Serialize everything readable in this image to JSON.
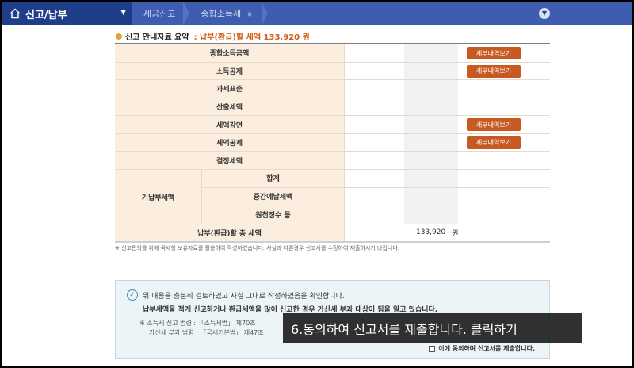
{
  "nav": {
    "main_label": "신고/납부",
    "crumbs": [
      "세금신고",
      "종합소득세"
    ],
    "star": "★"
  },
  "summary": {
    "title": "신고 안내자료 요약",
    "amount_text": ": 납부(환급)할 세액 133,920 원"
  },
  "table": {
    "rows": [
      {
        "label": "종합소득금액",
        "button": "세부내역보기"
      },
      {
        "label": "소득공제",
        "button": "세부내역보기"
      },
      {
        "label": "과세표준"
      },
      {
        "label": "산출세액"
      },
      {
        "label": "세액감면",
        "button": "세부내역보기"
      },
      {
        "label": "세액공제",
        "button": "세부내역보기"
      },
      {
        "label": "결정세액"
      }
    ],
    "prepaid": {
      "label": "기납부세액",
      "subs": [
        "합계",
        "중간예납세액",
        "원천징수 등"
      ]
    },
    "total": {
      "label": "납부(환급)할 총 세액",
      "value": "133,920",
      "unit": "원"
    }
  },
  "note": "※ 신고편의를 위해 국세청 보유자료를 활용하여 작성하였습니다. 사실과 다른경우 신고서를 수정하여 제출하시기 바랍니다.",
  "agree": {
    "line1": "위 내용을 충분히 검토하였고 사실 그대로 작성하였음을 확인합니다.",
    "line2": "납부세액을 적게 신고하거나 환급세액을 많이 신고한 경우 가산세 부과 대상이 됨을 알고 있습니다.",
    "line3": "※ 소득세 신고 법령 : 「소득세법」 제70조",
    "line4": "가산세 부과 법령 : 「국세기본법」 제47조",
    "checkbox_label": "이에 동의하며 신고서를 제출합니다."
  },
  "caption": "6.동의하여 신고서를 제출합니다. 클릭하기"
}
